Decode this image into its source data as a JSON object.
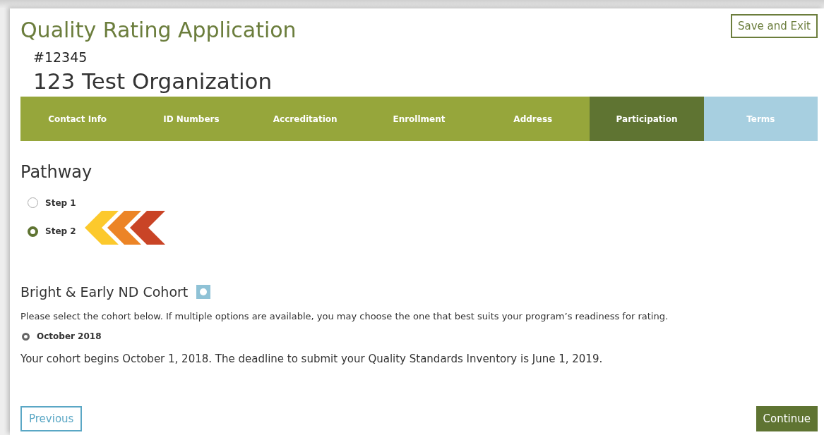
{
  "header": {
    "title": "Quality Rating Application",
    "save_button": "Save and Exit",
    "application_number": "#12345",
    "organization": "123 Test Organization"
  },
  "tabs": [
    {
      "label": "Contact Info",
      "selected": false,
      "disabled": false
    },
    {
      "label": "ID Numbers",
      "selected": false,
      "disabled": false
    },
    {
      "label": "Accreditation",
      "selected": false,
      "disabled": false
    },
    {
      "label": "Enrollment",
      "selected": false,
      "disabled": false
    },
    {
      "label": "Address",
      "selected": false,
      "disabled": false
    },
    {
      "label": "Participation",
      "selected": true,
      "disabled": false
    },
    {
      "label": "Terms",
      "selected": false,
      "disabled": true
    }
  ],
  "pathway": {
    "heading": "Pathway",
    "options": [
      {
        "label": "Step 1",
        "selected": false
      },
      {
        "label": "Step 2",
        "selected": true
      }
    ]
  },
  "cohort": {
    "heading": "Bright & Early ND Cohort",
    "instructions": "Please select the cohort below. If multiple options are available, you may choose the one that best suits your program’s readiness for rating.",
    "options": [
      {
        "label": "October 2018",
        "selected": true
      }
    ],
    "note": "Your cohort begins October 1, 2018. The deadline to submit your Quality Standards Inventory is June 1, 2019."
  },
  "footer": {
    "previous": "Previous",
    "continue": "Continue"
  }
}
